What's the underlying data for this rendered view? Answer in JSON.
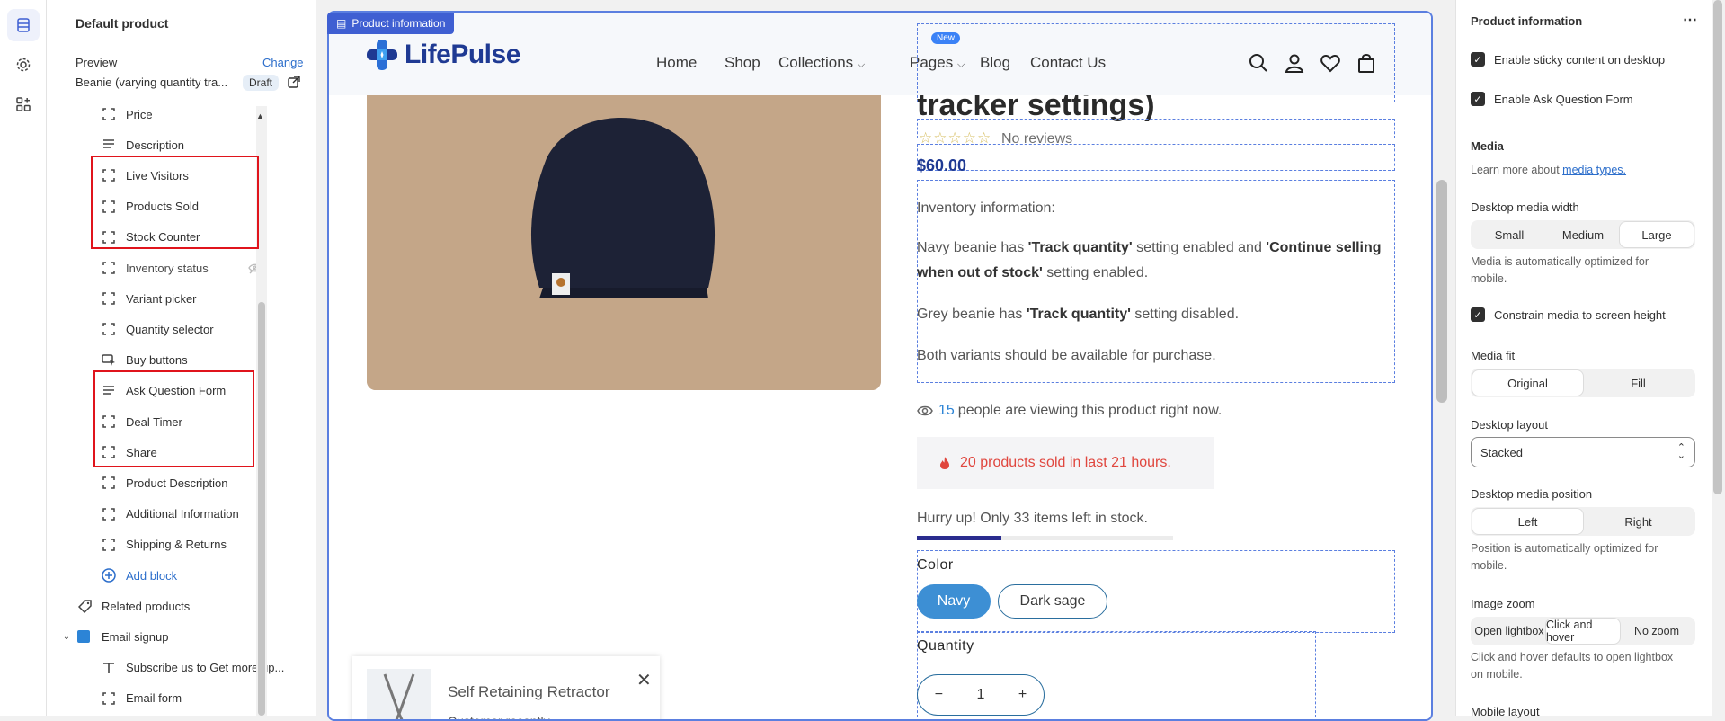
{
  "left_panel": {
    "title": "Default product",
    "preview_label": "Preview",
    "change_link": "Change",
    "product_name": "Beanie (varying quantity tra...",
    "draft_badge": "Draft",
    "blocks": [
      {
        "label": "Price",
        "icon": "block-icon"
      },
      {
        "label": "Description",
        "icon": "text-lines-icon"
      },
      {
        "label": "Live Visitors",
        "icon": "block-icon"
      },
      {
        "label": "Products Sold",
        "icon": "block-icon"
      },
      {
        "label": "Stock Counter",
        "icon": "block-icon"
      },
      {
        "label": "Inventory status",
        "icon": "block-icon",
        "hidden": true
      },
      {
        "label": "Variant picker",
        "icon": "block-icon"
      },
      {
        "label": "Quantity selector",
        "icon": "block-icon"
      },
      {
        "label": "Buy buttons",
        "icon": "cursor-click-icon"
      },
      {
        "label": "Ask Question Form",
        "icon": "text-lines-icon"
      },
      {
        "label": "Deal Timer",
        "icon": "block-icon"
      },
      {
        "label": "Share",
        "icon": "block-icon"
      },
      {
        "label": "Product Description",
        "icon": "block-icon"
      },
      {
        "label": "Additional Information",
        "icon": "block-icon"
      },
      {
        "label": "Shipping & Returns",
        "icon": "block-icon"
      }
    ],
    "add_block": "Add block",
    "related_products": "Related products",
    "email_signup": "Email signup",
    "email_children": [
      {
        "label": "Subscribe us to Get more up...",
        "icon": "text-t-icon"
      },
      {
        "label": "Email form",
        "icon": "block-icon"
      }
    ]
  },
  "preview": {
    "section_tag": "Product information",
    "brand": "LifePulse",
    "nav": [
      "Home",
      "Shop",
      "Collections",
      "Pages",
      "Blog",
      "Contact Us"
    ],
    "new_badge": "New",
    "title_fragment": "tracker settings)",
    "reviews": "No reviews",
    "stars": "☆☆☆☆☆",
    "price": "$60.00",
    "inventory_heading": "Inventory information:",
    "para1_pre": "Navy beanie has ",
    "para1_b1": "'Track quantity'",
    "para1_mid": " setting enabled and ",
    "para1_b2": "'Continue selling when out of stock'",
    "para1_post": " setting enabled.",
    "para2_pre": "Grey beanie has ",
    "para2_b": "'Track quantity'",
    "para2_post": " setting disabled.",
    "para3": "Both variants should be available for purchase.",
    "viewers_count": "15",
    "viewers_text": "people are viewing this product right now.",
    "sold_text": "20 products sold in last 21 hours.",
    "hurry_text": "Hurry up! Only 33 items left in stock.",
    "stock_progress_fraction": 0.33,
    "color_label": "Color",
    "colors": [
      "Navy",
      "Dark sage"
    ],
    "selected_color": "Navy",
    "quantity_label": "Quantity",
    "quantity_value": "1",
    "popup_title": "Self Retaining Retractor",
    "popup_sub": "Customer recently"
  },
  "right_panel": {
    "title": "Product information",
    "sticky": "Enable sticky content on desktop",
    "ask_form": "Enable Ask Question Form",
    "media_heading": "Media",
    "learn_more": "Learn more about ",
    "media_types_link": "media types.",
    "desktop_media_width": "Desktop media width",
    "width_options": [
      "Small",
      "Medium",
      "Large"
    ],
    "width_selected": "Large",
    "width_note": "Media is automatically optimized for mobile.",
    "constrain": "Constrain media to screen height",
    "media_fit": "Media fit",
    "fit_options": [
      "Original",
      "Fill"
    ],
    "fit_selected": "Original",
    "desktop_layout": "Desktop layout",
    "layout_value": "Stacked",
    "desktop_media_position": "Desktop media position",
    "position_options": [
      "Left",
      "Right"
    ],
    "position_selected": "Left",
    "position_note": "Position is automatically optimized for mobile.",
    "image_zoom": "Image zoom",
    "zoom_options": [
      "Open lightbox",
      "Click and hover",
      "No zoom"
    ],
    "zoom_selected": "Click and hover",
    "zoom_note": "Click and hover defaults to open lightbox on mobile.",
    "mobile_layout": "Mobile layout"
  },
  "colors": {
    "accent": "#3f5fd2",
    "brand": "#1f3a93",
    "sold_red": "#e0463e",
    "highlight": "#e0141c"
  }
}
